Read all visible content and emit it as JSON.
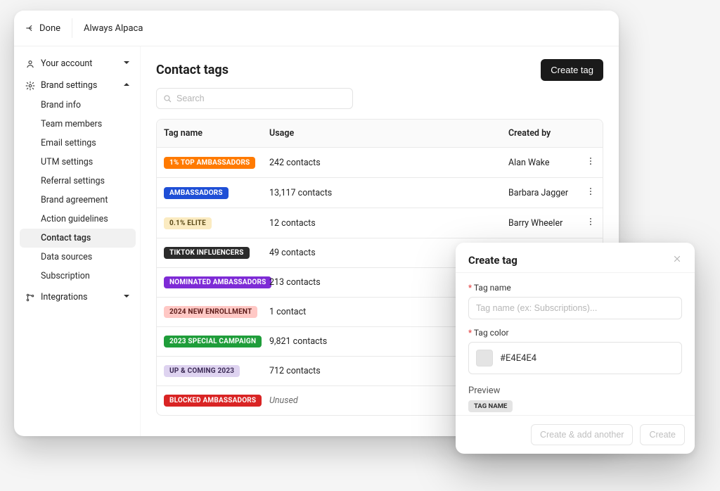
{
  "header": {
    "done": "Done",
    "brand": "Always Alpaca"
  },
  "sidebar": {
    "groups": [
      {
        "icon": "user-icon",
        "label": "Your account",
        "expanded": false,
        "items": []
      },
      {
        "icon": "gear-icon",
        "label": "Brand settings",
        "expanded": true,
        "items": [
          "Brand info",
          "Team members",
          "Email settings",
          "UTM settings",
          "Referral settings",
          "Brand agreement",
          "Action guidelines",
          "Contact tags",
          "Data sources",
          "Subscription"
        ],
        "activeIndex": 7
      },
      {
        "icon": "branch-icon",
        "label": "Integrations",
        "expanded": false,
        "items": []
      }
    ]
  },
  "page": {
    "title": "Contact tags",
    "create_btn": "Create tag",
    "search_placeholder": "Search"
  },
  "table": {
    "cols": {
      "tag": "Tag name",
      "usage": "Usage",
      "creator": "Created by"
    },
    "rows": [
      {
        "name": "1% TOP AMBASSADORS",
        "bg": "#ff7a00",
        "fg": "#ffffff",
        "usage": "242 contacts",
        "creator": "Alan Wake",
        "menu": true,
        "unused": false
      },
      {
        "name": "AMBASSADORS",
        "bg": "#1f4fd6",
        "fg": "#ffffff",
        "usage": "13,117 contacts",
        "creator": "Barbara Jagger",
        "menu": true,
        "unused": false
      },
      {
        "name": "0.1% ELITE",
        "bg": "#fbebc1",
        "fg": "#5b4a17",
        "usage": "12 contacts",
        "creator": "Barry Wheeler",
        "menu": true,
        "unused": false
      },
      {
        "name": "TIKTOK INFLUENCERS",
        "bg": "#2b2b2b",
        "fg": "#ffffff",
        "usage": "49 contacts",
        "creator": "",
        "menu": false,
        "unused": false
      },
      {
        "name": "NOMINATED AMBASSADORS",
        "bg": "#7e2bd6",
        "fg": "#ffffff",
        "usage": "213 contacts",
        "creator": "",
        "menu": false,
        "unused": false
      },
      {
        "name": "2024 NEW ENROLLMENT",
        "bg": "#ffc8c5",
        "fg": "#5c1c19",
        "usage": "1 contact",
        "creator": "",
        "menu": false,
        "unused": false
      },
      {
        "name": "2023 SPECIAL CAMPAIGN",
        "bg": "#1f9d3a",
        "fg": "#ffffff",
        "usage": "9,821 contacts",
        "creator": "",
        "menu": false,
        "unused": false
      },
      {
        "name": "UP & COMING 2023",
        "bg": "#ded3f0",
        "fg": "#3b2a55",
        "usage": "712 contacts",
        "creator": "",
        "menu": false,
        "unused": false
      },
      {
        "name": "BLOCKED AMBASSADORS",
        "bg": "#d92424",
        "fg": "#ffffff",
        "usage": "Unused",
        "creator": "",
        "menu": false,
        "unused": true
      }
    ]
  },
  "modal": {
    "title": "Create tag",
    "name_label": "Tag name",
    "name_placeholder": "Tag name (ex: Subscriptions)...",
    "color_label": "Tag color",
    "color_value": "#E4E4E4",
    "preview_label": "Preview",
    "preview_text": "TAG NAME",
    "btn_add_another": "Create & add another",
    "btn_create": "Create"
  }
}
